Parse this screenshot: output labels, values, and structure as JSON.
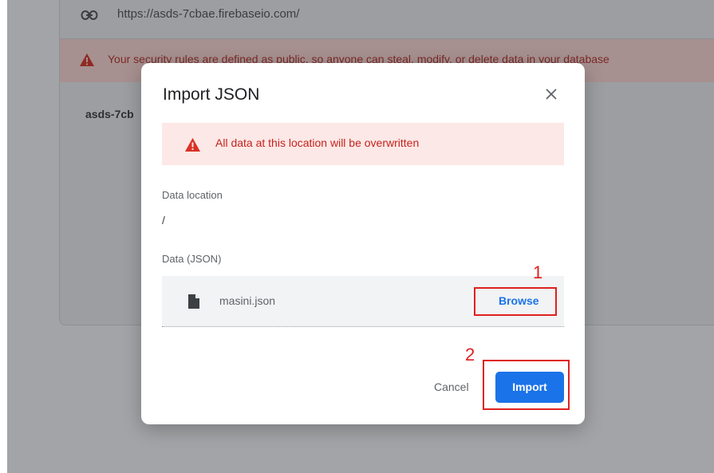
{
  "background": {
    "url": "https://asds-7cbae.firebaseio.com/",
    "security_warning": "Your security rules are defined as public, so anyone can steal, modify, or delete data in your database",
    "db_name": "asds-7cb"
  },
  "modal": {
    "title": "Import JSON",
    "alert": "All data at this location will be overwritten",
    "location_label": "Data location",
    "location_value": "/",
    "json_label": "Data (JSON)",
    "file_name": "masini.json",
    "browse_label": "Browse",
    "cancel_label": "Cancel",
    "import_label": "Import"
  },
  "annotations": {
    "step1": "1",
    "step2": "2"
  },
  "colors": {
    "accent": "#1a73e8",
    "error": "#c5221f",
    "annotation": "#e02020"
  }
}
